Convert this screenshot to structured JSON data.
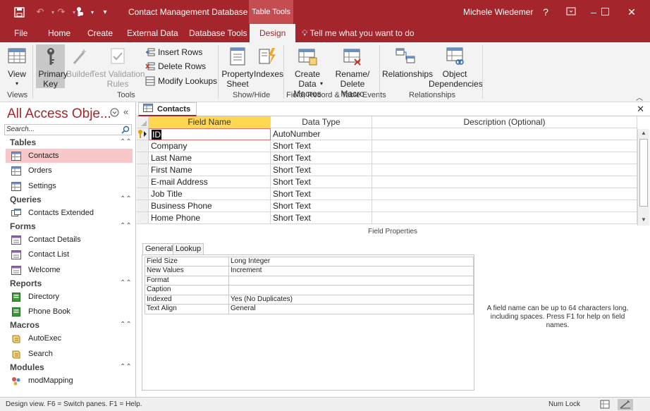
{
  "titlebar": {
    "app_title": "Contact Management Database",
    "context_tab": "Table Tools",
    "user": "Michele Wiedemer",
    "help": "?"
  },
  "tabs": [
    {
      "label": "File"
    },
    {
      "label": "Home"
    },
    {
      "label": "Create"
    },
    {
      "label": "External Data"
    },
    {
      "label": "Database Tools"
    },
    {
      "label": "Design"
    }
  ],
  "tell_me": "Tell me what you want to do",
  "ribbon": {
    "view": "View",
    "primary_key": "Primary Key",
    "builder": "Builder",
    "test_validation": "Test Validation Rules",
    "insert_rows": "Insert Rows",
    "delete_rows": "Delete Rows",
    "modify_lookups": "Modify Lookups",
    "property_sheet": "Property Sheet",
    "indexes": "Indexes",
    "create_data_macros": "Create Data Macros",
    "rename_delete_macro": "Rename/ Delete Macro",
    "relationships": "Relationships",
    "object_dependencies": "Object Dependencies",
    "groups": {
      "views": "Views",
      "tools": "Tools",
      "show_hide": "Show/Hide",
      "field_record": "Field, Record & Table Events",
      "relationships": "Relationships"
    }
  },
  "nav": {
    "title": "All Access Obje...",
    "search_placeholder": "Search...",
    "sections": {
      "tables": "Tables",
      "queries": "Queries",
      "forms": "Forms",
      "reports": "Reports",
      "macros": "Macros",
      "modules": "Modules"
    },
    "tables": [
      "Contacts",
      "Orders",
      "Settings"
    ],
    "queries": [
      "Contacts Extended"
    ],
    "forms": [
      "Contact Details",
      "Contact List",
      "Welcome"
    ],
    "reports": [
      "Directory",
      "Phone Book"
    ],
    "macros": [
      "AutoExec",
      "Search"
    ],
    "modules": [
      "modMapping"
    ]
  },
  "document": {
    "tab_label": "Contacts",
    "columns": {
      "field_name": "Field Name",
      "data_type": "Data Type",
      "description": "Description (Optional)"
    },
    "rows": [
      {
        "field": "ID",
        "type": "AutoNumber"
      },
      {
        "field": "Company",
        "type": "Short Text"
      },
      {
        "field": "Last Name",
        "type": "Short Text"
      },
      {
        "field": "First Name",
        "type": "Short Text"
      },
      {
        "field": "E-mail Address",
        "type": "Short Text"
      },
      {
        "field": "Job Title",
        "type": "Short Text"
      },
      {
        "field": "Business Phone",
        "type": "Short Text"
      },
      {
        "field": "Home Phone",
        "type": "Short Text"
      }
    ]
  },
  "field_properties": {
    "title": "Field Properties",
    "tabs": [
      "General",
      "Lookup"
    ],
    "rows": [
      {
        "name": "Field Size",
        "value": "Long Integer"
      },
      {
        "name": "New Values",
        "value": "Increment"
      },
      {
        "name": "Format",
        "value": ""
      },
      {
        "name": "Caption",
        "value": ""
      },
      {
        "name": "Indexed",
        "value": "Yes (No Duplicates)"
      },
      {
        "name": "Text Align",
        "value": "General"
      }
    ],
    "help": "A field name can be up to 64 characters long, including spaces. Press F1 for help on field names."
  },
  "status": {
    "text": "Design view.  F6 = Switch panes.  F1 = Help.",
    "num_lock": "Num Lock"
  },
  "colors": {
    "accent": "#a4262c",
    "header_highlight": "#ffd850",
    "nav_selected": "#f8c8c9"
  }
}
